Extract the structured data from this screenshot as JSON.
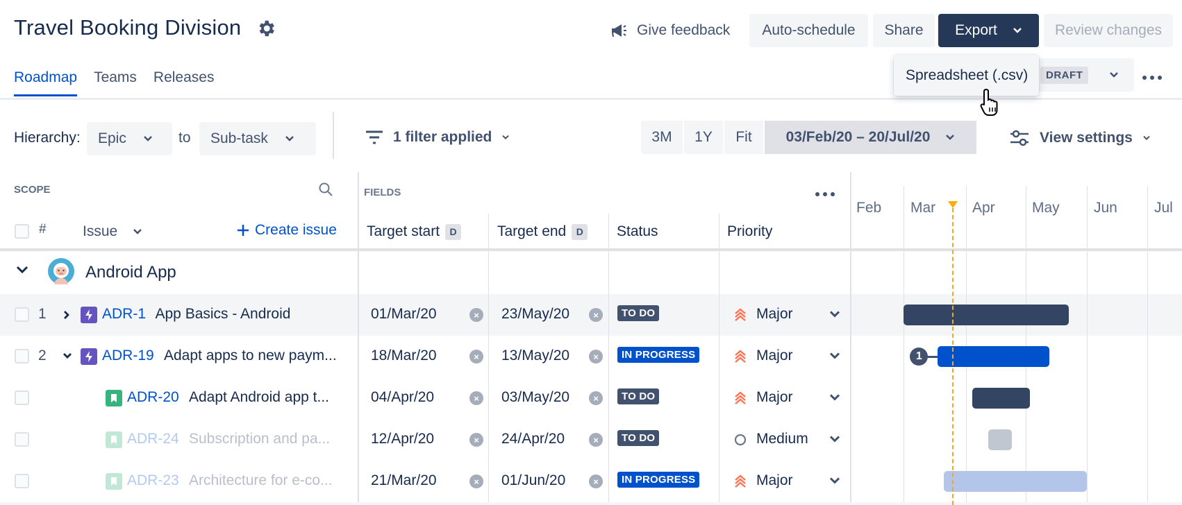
{
  "header": {
    "title": "Travel Booking Division",
    "settings_icon": "gear-icon",
    "feedback_label": "Give feedback",
    "feedback_icon": "megaphone-icon",
    "buttons": {
      "auto_schedule": "Auto-schedule",
      "share": "Share",
      "export": "Export",
      "review": "Review changes"
    }
  },
  "tabs": [
    {
      "label": "Roadmap",
      "active": true
    },
    {
      "label": "Teams",
      "active": false
    },
    {
      "label": "Releases",
      "active": false
    }
  ],
  "export_menu": {
    "items": [
      "Spreadsheet (.csv)"
    ]
  },
  "plan_status": {
    "badge": "DRAFT"
  },
  "toolbar": {
    "hierarchy_label": "Hierarchy:",
    "hierarchy_from": "Epic",
    "to_label": "to",
    "hierarchy_to": "Sub-task",
    "filter_label": "1 filter applied",
    "zoom_options": [
      "3M",
      "1Y",
      "Fit"
    ],
    "date_range": "03/Feb/20 – 20/Jul/20",
    "view_settings": "View settings"
  },
  "scope": {
    "label": "SCOPE",
    "hash": "#",
    "issue_col": "Issue",
    "create_issue": "Create issue"
  },
  "fields": {
    "label": "FIELDS",
    "columns": {
      "target_start": "Target start",
      "target_end": "Target end",
      "status": "Status",
      "priority": "Priority",
      "date_badge": "D"
    }
  },
  "timeline": {
    "months": [
      "Feb",
      "Mar",
      "Apr",
      "May",
      "Jun",
      "Jul"
    ],
    "colors": {
      "todo": "#344563",
      "in_progress": "#0052cc",
      "today": "#ffab00"
    }
  },
  "group": {
    "name": "Android App"
  },
  "rows": [
    {
      "num": "1",
      "key": "ADR-1",
      "summary": "App Basics - Android",
      "type": "epic",
      "start": "01/Mar/20",
      "end": "23/May/20",
      "status": "TO DO",
      "priority": "Major",
      "faded": false
    },
    {
      "num": "2",
      "key": "ADR-19",
      "summary": "Adapt apps to new paym...",
      "type": "epic",
      "start": "18/Mar/20",
      "end": "13/May/20",
      "status": "IN PROGRESS",
      "priority": "Major",
      "faded": false,
      "dependency_count": "1"
    },
    {
      "num": "",
      "key": "ADR-20",
      "summary": "Adapt Android app t...",
      "type": "story",
      "start": "04/Apr/20",
      "end": "03/May/20",
      "status": "TO DO",
      "priority": "Major",
      "faded": false
    },
    {
      "num": "",
      "key": "ADR-24",
      "summary": "Subscription and pa...",
      "type": "story",
      "start": "12/Apr/20",
      "end": "24/Apr/20",
      "status": "TO DO",
      "priority": "Medium",
      "faded": true
    },
    {
      "num": "",
      "key": "ADR-23",
      "summary": "Architecture for e-co...",
      "type": "story",
      "start": "21/Mar/20",
      "end": "01/Jun/20",
      "status": "IN PROGRESS",
      "priority": "Major",
      "faded": true
    }
  ]
}
